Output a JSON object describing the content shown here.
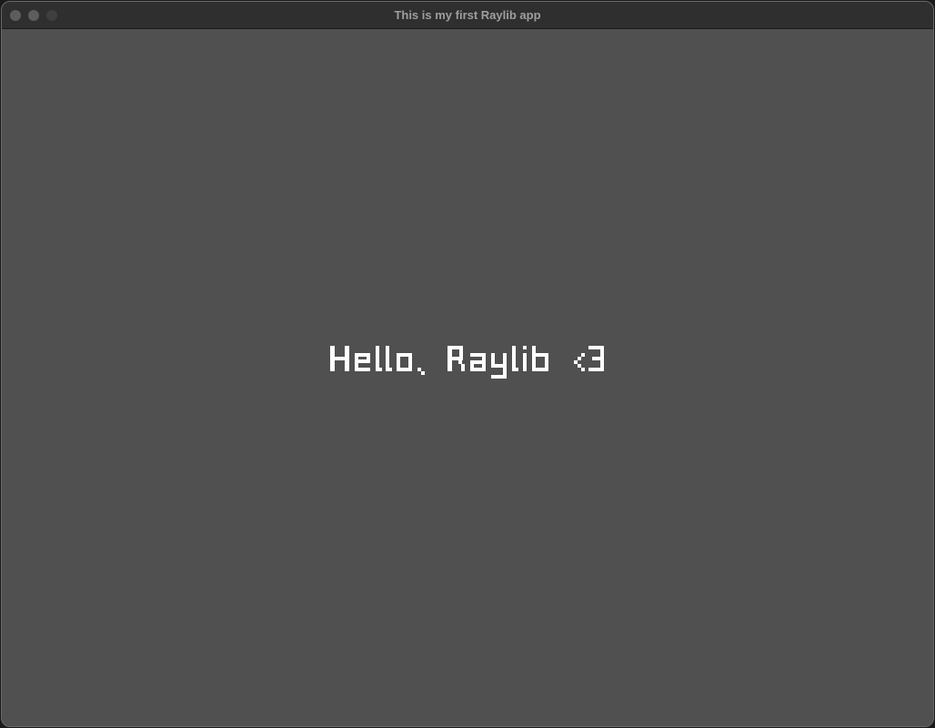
{
  "window": {
    "title": "This is my first Raylib app",
    "controls": {
      "close": "close-button",
      "minimize": "minimize-button",
      "zoom": "zoom-button"
    }
  },
  "canvas": {
    "background": "#505050",
    "message": "Hello, Raylib <3",
    "message_color": "#ffffff"
  }
}
